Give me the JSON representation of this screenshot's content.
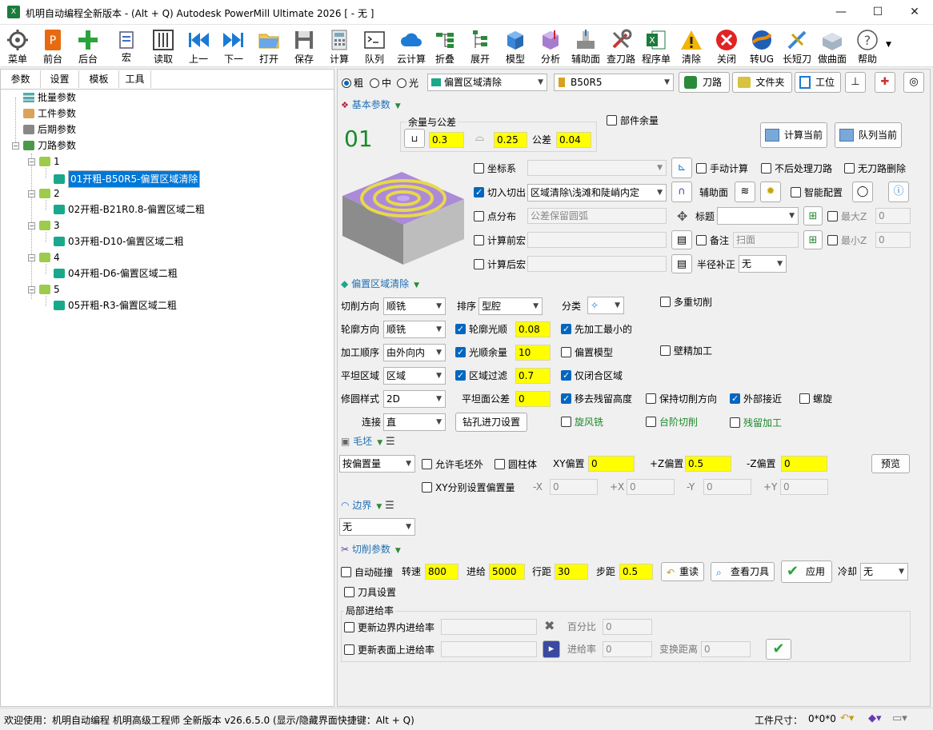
{
  "window": {
    "title": "机明自动编程全新版本 - (Alt + Q) Autodesk PowerMill Ultimate 2026    [  - 无 ]",
    "app_icon": "xlsx-icon"
  },
  "toolbar": [
    "菜单",
    "前台",
    "后台",
    "宏",
    "读取",
    "上一",
    "下一",
    "打开",
    "保存",
    "计算",
    "队列",
    "云计算",
    "折叠",
    "展开",
    "模型",
    "分析",
    "辅助面",
    "查刀路",
    "程序单",
    "清除",
    "关闭",
    "转UG",
    "长短刀",
    "做曲面",
    "帮助"
  ],
  "left": {
    "tabs": [
      "参数",
      "设置",
      "模板",
      "工具"
    ],
    "tree": {
      "batch": "批量参数",
      "workpiece": "工件参数",
      "post": "后期参数",
      "toolpath": "刀路参数",
      "groups": [
        {
          "num": "1",
          "item": "01开粗-B50R5-偏置区域清除"
        },
        {
          "num": "2",
          "item": "02开粗-B21R0.8-偏置区域二粗"
        },
        {
          "num": "3",
          "item": "03开粗-D10-偏置区域二粗"
        },
        {
          "num": "4",
          "item": "04开粗-D6-偏置区域二粗"
        },
        {
          "num": "5",
          "item": "05开粗-R3-偏置区域二粗"
        }
      ]
    }
  },
  "top": {
    "rough": "粗",
    "medium": "中",
    "finish": "光",
    "strategy": "偏置区域清除",
    "tool": "B50R5",
    "toolpath_btn": "刀路",
    "folder_btn": "文件夹",
    "workplane_btn": "工位"
  },
  "basic": {
    "section": "基本参数",
    "number": "01",
    "tol_group": "余量与公差",
    "allow1": "0.3",
    "allow2": "0.25",
    "tol_label": "公差",
    "tol": "0.04",
    "part_allow": "部件余量",
    "calc_now": "计算当前",
    "queue_now": "队列当前",
    "coord": "坐标系",
    "manual_calc": "手动计算",
    "no_post": "不后处理刀路",
    "no_del": "无刀路删除",
    "leadin": "切入切出",
    "leadin_value": "区域清除\\浅滩和陡峭内定",
    "aux_surface": "辅助面",
    "smart_cfg": "智能配置",
    "points": "点分布",
    "points_value": "公差保留圆弧",
    "title_lbl": "标题",
    "maxz": "最大Z",
    "maxz_val": "0",
    "pre_macro": "计算前宏",
    "note": "备注",
    "note_val": "扫面",
    "minz": "最小Z",
    "minz_val": "0",
    "post_macro": "计算后宏",
    "radcomp": "半径补正",
    "radcomp_val": "无"
  },
  "offset": {
    "section": "偏置区域清除",
    "cut_dir": "切削方向",
    "cut_dir_val": "顺铣",
    "sort": "排序",
    "sort_val": "型腔",
    "classify": "分类",
    "multi_cut": "多重切削",
    "profile_dir": "轮廓方向",
    "profile_dir_val": "顺铣",
    "profile_smooth": "轮廓光顺",
    "profile_smooth_val": "0.08",
    "min_first": "先加工最小的",
    "order": "加工顺序",
    "order_val": "由外向内",
    "smooth_allow": "光顺余量",
    "smooth_allow_val": "10",
    "offset_model": "偏置模型",
    "wall_finish": "壁精加工",
    "flat": "平坦区域",
    "flat_val": "区域",
    "area_filter": "区域过滤",
    "area_filter_val": "0.7",
    "closed_only": "仅闭合区域",
    "fillet": "修圆样式",
    "fillet_val": "2D",
    "flat_tol": "平坦面公差",
    "flat_tol_val": "0",
    "remove_rest": "移去残留高度",
    "keep_dir": "保持切削方向",
    "outer_approach": "外部接近",
    "spiral": "螺旋",
    "connect": "连接",
    "connect_val": "直",
    "drill_btn": "钻孔进刀设置",
    "trochoid": "旋风铣",
    "step_cut": "台阶切削",
    "rest_mach": "残留加工"
  },
  "stock": {
    "section": "毛坯",
    "mode": "按偏置量",
    "allow_out": "允许毛坯外",
    "cylinder": "圆柱体",
    "xy": "XY偏置",
    "xy_val": "0",
    "pz": "+Z偏置",
    "pz_val": "0.5",
    "nz": "-Z偏置",
    "nz_val": "0",
    "preview": "预览",
    "xy_separate": "XY分别设置偏置量",
    "mx": "-X",
    "mx_val": "0",
    "px": "+X",
    "px_val": "0",
    "my": "-Y",
    "my_val": "0",
    "py": "+Y",
    "py_val": "0"
  },
  "boundary": {
    "section": "边界",
    "val": "无"
  },
  "cutting": {
    "section": "切削参数",
    "auto_collide": "自动碰撞",
    "speed": "转速",
    "speed_val": "800",
    "feed": "进给",
    "feed_val": "5000",
    "row": "行距",
    "row_val": "30",
    "step": "步距",
    "step_val": "0.5",
    "reread": "重读",
    "view_tool": "查看刀具",
    "apply": "应用",
    "cool": "冷却",
    "cool_val": "无",
    "tool_set": "刀具设置",
    "local_feed": "局部进给率",
    "upd_boundary": "更新边界内进给率",
    "percent": "百分比",
    "percent_val": "0",
    "upd_surface": "更新表面上进给率",
    "feedrate": "进给率",
    "feedrate_val": "0",
    "trans_dist": "变换距离",
    "trans_dist_val": "0"
  },
  "status": {
    "welcome": "欢迎使用：机明自动编程 机明高级工程师 全新版本 v26.6.5.0  (显示/隐藏界面快捷键：Alt + Q)",
    "work_size_lbl": "工件尺寸：",
    "work_size": "0*0*0"
  },
  "colors": {
    "input_yellow": "#ffff00",
    "select_blue": "#0078d7",
    "section_blue": "#1f6fb5"
  }
}
